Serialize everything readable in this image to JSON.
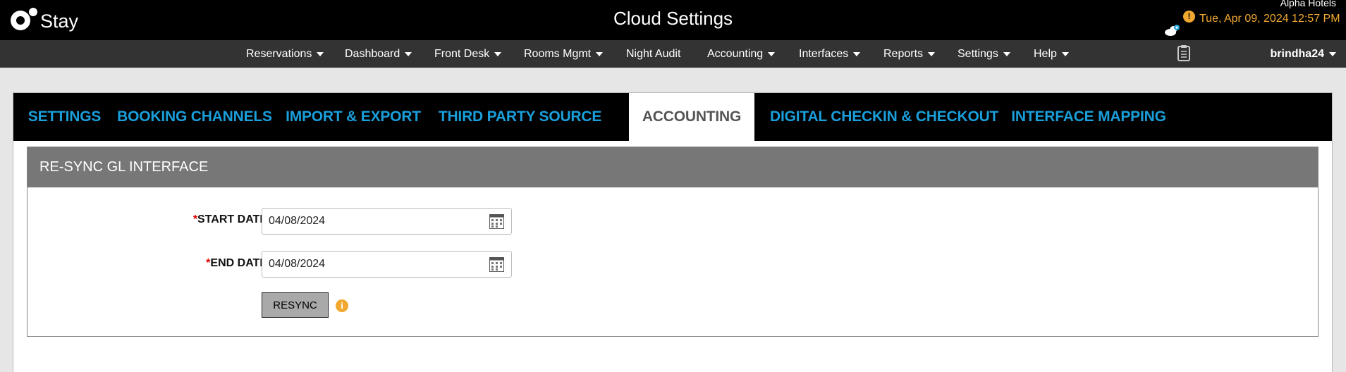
{
  "header": {
    "logo_text": "Stay",
    "title": "Cloud Settings",
    "hotel_name": "Alpha Hotels",
    "datetime": "Tue, Apr 09, 2024 12:57 PM",
    "alert_symbol": "!",
    "accent_color": "#f0a830"
  },
  "nav": {
    "items": [
      {
        "label": "Reservations",
        "dropdown": true
      },
      {
        "label": "Dashboard",
        "dropdown": true
      },
      {
        "label": "Front Desk",
        "dropdown": true
      },
      {
        "label": "Rooms Mgmt",
        "dropdown": true
      },
      {
        "label": "Night Audit",
        "dropdown": false
      },
      {
        "label": "Accounting",
        "dropdown": true
      },
      {
        "label": "Interfaces",
        "dropdown": true
      },
      {
        "label": "Reports",
        "dropdown": true
      },
      {
        "label": "Settings",
        "dropdown": true
      },
      {
        "label": "Help",
        "dropdown": true
      }
    ],
    "user": "brindha24"
  },
  "tabs": [
    {
      "label": "SETTINGS",
      "active": false
    },
    {
      "label": "BOOKING CHANNELS",
      "active": false
    },
    {
      "label": "IMPORT & EXPORT",
      "active": false
    },
    {
      "label": "THIRD PARTY SOURCE",
      "active": false
    },
    {
      "label": "ACCOUNTING",
      "active": true
    },
    {
      "label": "DIGITAL CHECKIN & CHECKOUT",
      "active": false
    },
    {
      "label": "INTERFACE MAPPING",
      "active": false
    }
  ],
  "panel": {
    "title": "RE-SYNC GL INTERFACE",
    "required_marker": "*",
    "start_date": {
      "label": "START DATE",
      "value": "04/08/2024"
    },
    "end_date": {
      "label": "END DATE",
      "value": "04/08/2024"
    },
    "resync_label": "RESYNC",
    "info_symbol": "i"
  }
}
